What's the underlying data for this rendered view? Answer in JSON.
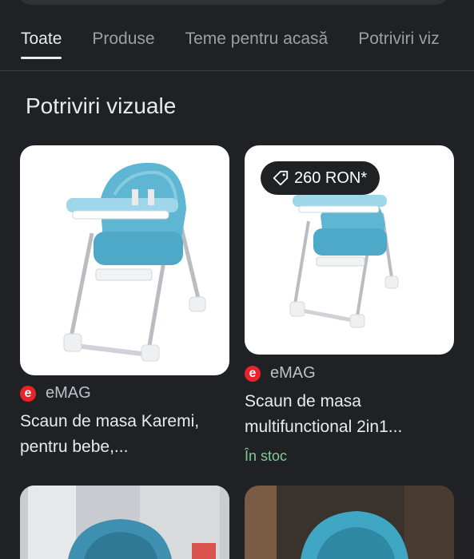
{
  "tabs": [
    {
      "label": "Toate",
      "active": true
    },
    {
      "label": "Produse",
      "active": false
    },
    {
      "label": "Teme pentru acasă",
      "active": false
    },
    {
      "label": "Potriviri viz",
      "active": false
    }
  ],
  "section_title": "Potriviri vizuale",
  "cards": [
    {
      "source": "eMAG",
      "title_line1": "Scaun de masa Karemi,",
      "title_line2": "pentru bebe,..."
    },
    {
      "price": "260 RON*",
      "source": "eMAG",
      "title_line1": "Scaun de masa",
      "title_line2": "multifunctional 2in1...",
      "stock": "În stoc"
    }
  ],
  "colors": {
    "background": "#202124",
    "chair_seat": "#5fb6d3",
    "stock_green": "#81c995",
    "emag_red": "#e8232a"
  },
  "icons": [
    "price-tag-icon",
    "emag-logo-icon"
  ]
}
